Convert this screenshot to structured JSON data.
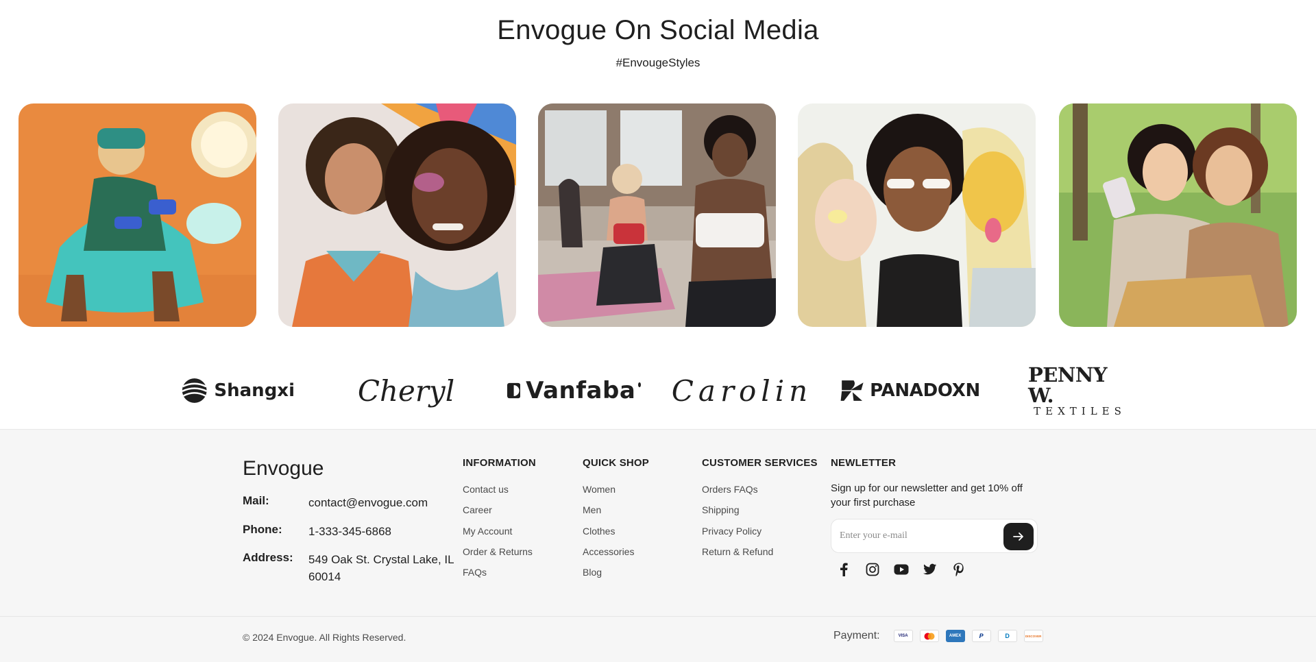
{
  "social": {
    "title": "Envogue On Social Media",
    "hashtag": "#EnvougeStyles"
  },
  "brands": {
    "shangxi": "Shangxi",
    "cheryl": "Cheryl",
    "vanfaba": "Vanfaba",
    "carolin": "Carolin",
    "panadoxn": "PANADOXN",
    "penny_line1": "PENNY W.",
    "penny_line2": "TEXTILES"
  },
  "footer": {
    "logo": "Envogue",
    "contact": {
      "mail_label": "Mail:",
      "mail_value": "contact@envogue.com",
      "phone_label": "Phone:",
      "phone_value": "1-333-345-6868",
      "address_label": "Address:",
      "address_value": "549 Oak St. Crystal Lake, IL 60014"
    },
    "information": {
      "heading": "INFORMATION",
      "items": [
        "Contact us",
        "Career",
        "My Account",
        "Order & Returns",
        "FAQs"
      ]
    },
    "quick_shop": {
      "heading": "QUICK SHOP",
      "items": [
        "Women",
        "Men",
        "Clothes",
        "Accessories",
        "Blog"
      ]
    },
    "customer_services": {
      "heading": "CUSTOMER SERVICES",
      "items": [
        "Orders FAQs",
        "Shipping",
        "Privacy Policy",
        "Return & Refund"
      ]
    },
    "newsletter": {
      "heading": "NEWLETTER",
      "description": "Sign up for our newsletter and get 10% off your first purchase",
      "placeholder": "Enter your e-mail"
    },
    "social_icons": [
      "facebook-icon",
      "instagram-icon",
      "youtube-icon",
      "twitter-icon",
      "pinterest-icon"
    ]
  },
  "bottom": {
    "copyright": "© 2024 Envogue. All Rights Reserved.",
    "payment_label": "Payment:",
    "cards": {
      "visa": "VISA",
      "mastercard": "",
      "amex": "AMEX",
      "paypal": "P",
      "diners": "D",
      "discover": "DISCOVER"
    }
  },
  "colors": {
    "text": "#1f1f1f",
    "muted": "#4a4a4a",
    "footer_bg": "#f6f6f6",
    "button_dark": "#1f1f1f"
  }
}
